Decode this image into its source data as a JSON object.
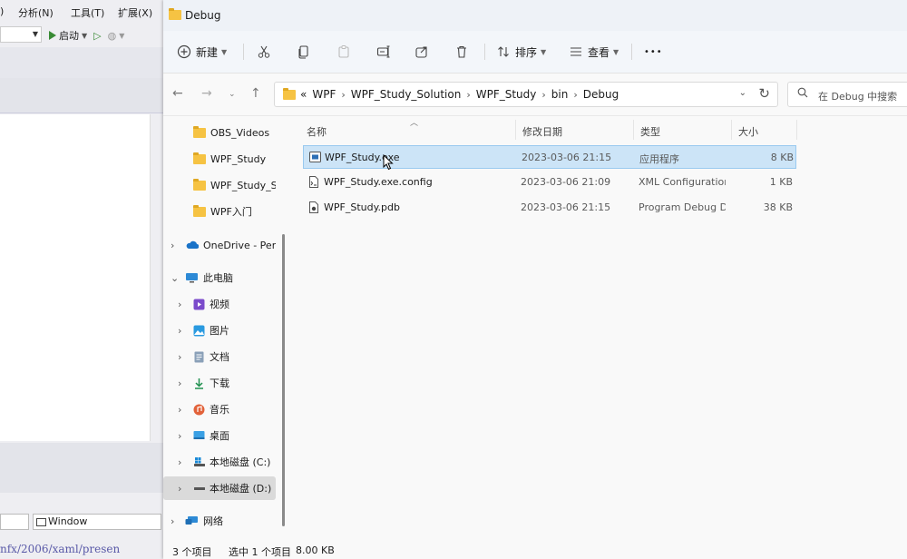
{
  "vs": {
    "menu": [
      "分析(N)",
      "工具(T)",
      "扩展(X)"
    ],
    "start_label": "启动",
    "window_combo": "Window",
    "code_snippet": "nfx/2006/xaml/presen"
  },
  "explorer": {
    "title": "Debug",
    "toolbar": {
      "new_label": "新建",
      "sort_label": "排序",
      "view_label": "查看",
      "more_label": "•••"
    },
    "path": {
      "overflow": "«",
      "crumbs": [
        "WPF",
        "WPF_Study_Solution",
        "WPF_Study",
        "bin",
        "Debug"
      ]
    },
    "search": {
      "placeholder": "在 Debug 中搜索"
    },
    "nav": {
      "folders": [
        "OBS_Videos",
        "WPF_Study",
        "WPF_Study_Solution",
        "WPF入门"
      ],
      "onedrive": "OneDrive - Personal",
      "this_pc": "此电脑",
      "pc_items": [
        "视频",
        "图片",
        "文档",
        "下载",
        "音乐",
        "桌面",
        "本地磁盘 (C:)",
        "本地磁盘 (D:)"
      ],
      "network": "网络"
    },
    "columns": {
      "name": "名称",
      "date": "修改日期",
      "type": "类型",
      "size": "大小"
    },
    "files": [
      {
        "name": "WPF_Study.exe",
        "date": "2023-03-06 21:15",
        "type": "应用程序",
        "size": "8 KB",
        "selected": true
      },
      {
        "name": "WPF_Study.exe.config",
        "date": "2023-03-06 21:09",
        "type": "XML Configuration File",
        "size": "1 KB",
        "selected": false
      },
      {
        "name": "WPF_Study.pdb",
        "date": "2023-03-06 21:15",
        "type": "Program Debug Database",
        "size": "38 KB",
        "selected": false
      }
    ],
    "status": {
      "count": "3 个项目",
      "selection": "选中 1 个项目",
      "selection_size": "8.00 KB"
    }
  }
}
